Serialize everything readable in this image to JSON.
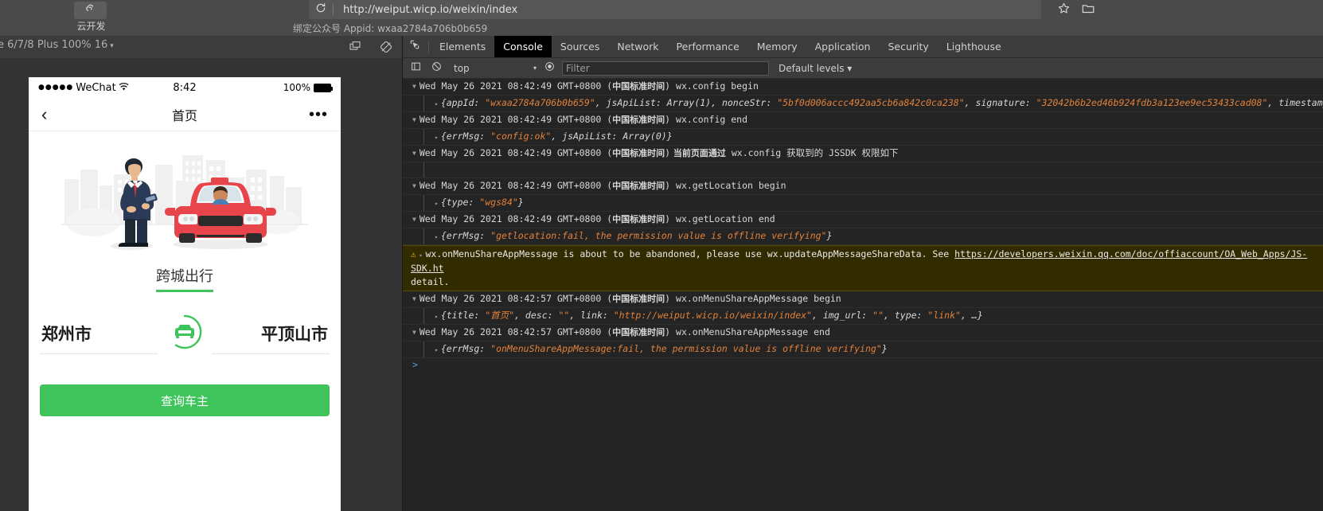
{
  "browser": {
    "cloud_dev_label": "云开发",
    "cloud_dev_icon": "cloud-dev-icon",
    "reload_icon": "reload-icon",
    "url": "http://weiput.wicp.io/weixin/index",
    "appid_line": "绑定公众号 Appid: wxaa2784a706b0b659",
    "star_icon": "star-icon",
    "folder_icon": "folder-icon"
  },
  "device_toolbar": {
    "device_label": "e 6/7/8 Plus 100% 16",
    "caret": "▾",
    "cast_icon": "screencast-icon",
    "rotate_icon": "rotate-icon"
  },
  "phone": {
    "status": {
      "dots": "●●●●●",
      "carrier": "WeChat",
      "wifi_icon": "wifi-icon",
      "time": "8:42",
      "battery_pct": "100%",
      "battery_icon": "battery-full-icon"
    },
    "nav": {
      "back_icon": "back-chevron-icon",
      "title": "首页",
      "more_icon": "more-dots-icon"
    },
    "hero_illustration": "man-with-phone-and-taxi-illustration",
    "section_title": "跨城出行",
    "origin_city": "郑州市",
    "destination_city": "平顶山市",
    "swap_icon": "car-circle-swap-icon",
    "query_button": "查询车主"
  },
  "devtools": {
    "inspect_icon": "inspect-element-icon",
    "device_toggle_icon": "device-toolbar-icon",
    "tabs": [
      {
        "label": "Elements",
        "active": false
      },
      {
        "label": "Console",
        "active": true
      },
      {
        "label": "Sources",
        "active": false
      },
      {
        "label": "Network",
        "active": false
      },
      {
        "label": "Performance",
        "active": false
      },
      {
        "label": "Memory",
        "active": false
      },
      {
        "label": "Application",
        "active": false
      },
      {
        "label": "Security",
        "active": false
      },
      {
        "label": "Lighthouse",
        "active": false
      }
    ],
    "subbar": {
      "sidebar_icon": "console-sidebar-icon",
      "clear_icon": "clear-console-icon",
      "context": "top",
      "context_caret": "▾",
      "eye_icon": "live-expression-icon",
      "filter_placeholder": "Filter",
      "filter_value": "",
      "levels": "Default levels",
      "levels_caret": "▾"
    },
    "console": {
      "entries": [
        {
          "type": "group",
          "tri": "▼",
          "ts_en": "Wed May 26 2021 08:42:49 GMT+0800 (",
          "ts_zh": "中国标准时间",
          "ts_end": ")",
          "msg": " wx.config begin"
        },
        {
          "type": "object",
          "tri": "▸",
          "parts": [
            {
              "t": "plain",
              "v": "{appId: "
            },
            {
              "t": "str",
              "v": "\"wxaa2784a706b0b659\""
            },
            {
              "t": "plain",
              "v": ", jsApiList: Array(1), nonceStr: "
            },
            {
              "t": "str",
              "v": "\"5bf0d006accc492aa5cb6a842c0ca238\""
            },
            {
              "t": "plain",
              "v": ", signature: "
            },
            {
              "t": "str",
              "v": "\"32042b6b2ed46b924fdb3a123ee9ec53433cad08\""
            },
            {
              "t": "plain",
              "v": ", timestamp:"
            }
          ]
        },
        {
          "type": "group",
          "tri": "▼",
          "ts_en": "Wed May 26 2021 08:42:49 GMT+0800 (",
          "ts_zh": "中国标准时间",
          "ts_end": ")",
          "msg": " wx.config end"
        },
        {
          "type": "object",
          "tri": "▸",
          "parts": [
            {
              "t": "plain",
              "v": "{errMsg: "
            },
            {
              "t": "str",
              "v": "\"config:ok\""
            },
            {
              "t": "plain",
              "v": ", jsApiList: Array(0)}"
            }
          ]
        },
        {
          "type": "group",
          "tri": "▼",
          "ts_en": "Wed May 26 2021 08:42:49 GMT+0800 (",
          "ts_zh": "中国标准时间",
          "ts_end": ")",
          "msg_zh": " 当前页面通过",
          "msg": " wx.config 获取到的 JSSDK 权限如下"
        },
        {
          "type": "object",
          "tri": "",
          "parts": []
        },
        {
          "type": "group",
          "tri": "▼",
          "ts_en": "Wed May 26 2021 08:42:49 GMT+0800 (",
          "ts_zh": "中国标准时间",
          "ts_end": ")",
          "msg": " wx.getLocation begin"
        },
        {
          "type": "object",
          "tri": "▸",
          "parts": [
            {
              "t": "plain",
              "v": "{type: "
            },
            {
              "t": "str",
              "v": "\"wgs84\""
            },
            {
              "t": "plain",
              "v": "}"
            }
          ]
        },
        {
          "type": "group",
          "tri": "▼",
          "ts_en": "Wed May 26 2021 08:42:49 GMT+0800 (",
          "ts_zh": "中国标准时间",
          "ts_end": ")",
          "msg": " wx.getLocation end"
        },
        {
          "type": "object",
          "tri": "▸",
          "parts": [
            {
              "t": "plain",
              "v": "{errMsg: "
            },
            {
              "t": "str",
              "v": "\"getlocation:fail, the permission value is offline verifying\""
            },
            {
              "t": "plain",
              "v": "}"
            }
          ]
        },
        {
          "type": "warning",
          "icon": "warning-triangle-icon",
          "tri": "▸",
          "text_before": "wx.onMenuShareAppMessage is about to be abandoned, please use wx.updateAppMessageShareData. See ",
          "link": "https://developers.weixin.qq.com/doc/offiaccount/OA_Web_Apps/JS-SDK.ht",
          "text_after": "detail."
        },
        {
          "type": "group",
          "tri": "▼",
          "ts_en": "Wed May 26 2021 08:42:57 GMT+0800 (",
          "ts_zh": "中国标准时间",
          "ts_end": ")",
          "msg": " wx.onMenuShareAppMessage begin"
        },
        {
          "type": "object",
          "tri": "▸",
          "parts": [
            {
              "t": "plain",
              "v": "{title: "
            },
            {
              "t": "str",
              "v": "\"首页\""
            },
            {
              "t": "plain",
              "v": ", desc: "
            },
            {
              "t": "str",
              "v": "\"\""
            },
            {
              "t": "plain",
              "v": ", link: "
            },
            {
              "t": "str",
              "v": "\"http://weiput.wicp.io/weixin/index\""
            },
            {
              "t": "plain",
              "v": ", img_url: "
            },
            {
              "t": "str",
              "v": "\"\""
            },
            {
              "t": "plain",
              "v": ", type: "
            },
            {
              "t": "str",
              "v": "\"link\""
            },
            {
              "t": "plain",
              "v": ", …}"
            }
          ]
        },
        {
          "type": "group",
          "tri": "▼",
          "ts_en": "Wed May 26 2021 08:42:57 GMT+0800 (",
          "ts_zh": "中国标准时间",
          "ts_end": ")",
          "msg": " wx.onMenuShareAppMessage end"
        },
        {
          "type": "object",
          "tri": "▸",
          "parts": [
            {
              "t": "plain",
              "v": "{errMsg: "
            },
            {
              "t": "str",
              "v": "\"onMenuShareAppMessage:fail, the permission value is offline verifying\""
            },
            {
              "t": "plain",
              "v": "}"
            }
          ]
        }
      ],
      "prompt": ">"
    }
  },
  "colors": {
    "wechat_green": "#3fc35b",
    "devtools_bg": "#242424",
    "chrome_bg": "#4a4a4a",
    "string_orange": "#e2813a",
    "warning_bg": "#332b00"
  }
}
